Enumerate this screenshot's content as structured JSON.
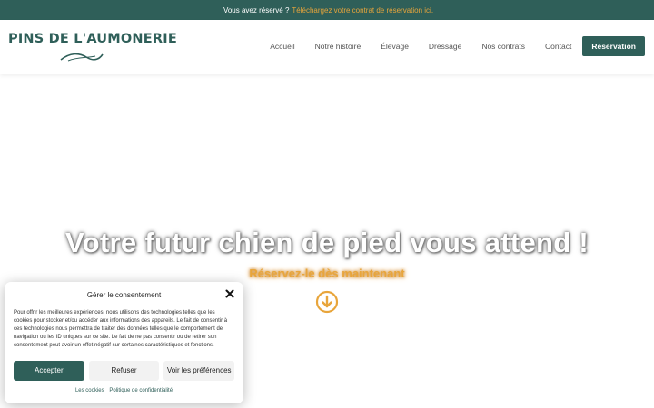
{
  "topbar": {
    "glyph": "",
    "text": "Vous avez réservé ?",
    "link": "Téléchargez votre contrat de réservation ici."
  },
  "logo": {
    "text": "PINS DE L'AUMONERIE"
  },
  "nav": {
    "items": [
      "Accueil",
      "Notre histoire",
      "Élevage",
      "Dressage",
      "Nos contrats",
      "Contact"
    ],
    "cta": "Réservation"
  },
  "hero": {
    "title": "Votre futur chien de pied vous attend !",
    "subtitle": "Réservez-le dès maintenant"
  },
  "consent": {
    "title": "Gérer le consentement",
    "body": "Pour offrir les meilleures expériences, nous utilisons des technologies telles que les cookies pour stocker et/ou accéder aux informations des appareils. Le fait de consentir à ces technologies nous permettra de traiter des données telles que le comportement de navigation ou les ID uniques sur ce site. Le fait de ne pas consentir ou de retirer son consentement peut avoir un effet négatif sur certaines caractéristiques et fonctions.",
    "accept": "Accepter",
    "refuse": "Refuser",
    "prefs": "Voir les préférences",
    "link_cookies": "Les cookies",
    "link_privacy": "Politique de confidentialité"
  },
  "colors": {
    "brand": "#2f5f59",
    "accent": "#e8a53b"
  },
  "icons": {
    "close": "close-icon",
    "down": "arrow-down-circle-icon"
  }
}
